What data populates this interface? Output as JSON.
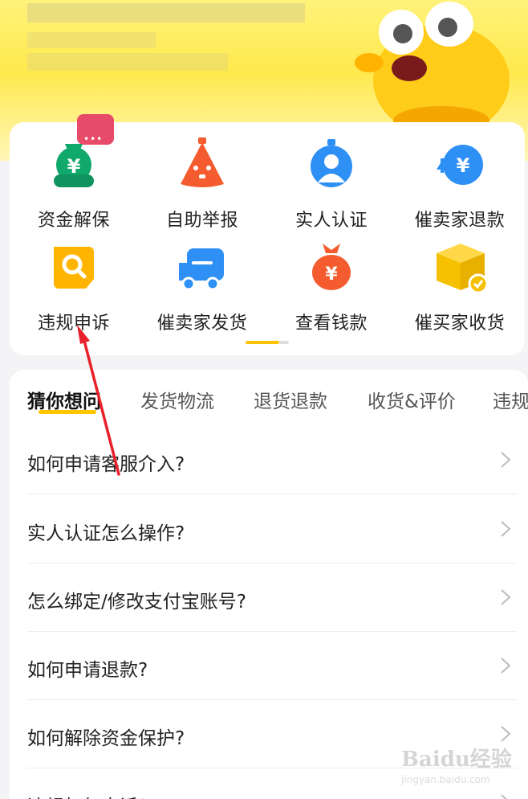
{
  "services": [
    {
      "label": "资金解保",
      "icon": "money-bag-icon",
      "color": "#11a86b"
    },
    {
      "label": "自助举报",
      "icon": "report-icon",
      "color": "#f45b2e"
    },
    {
      "label": "实人认证",
      "icon": "person-verify-icon",
      "color": "#2e8ff5"
    },
    {
      "label": "催卖家退款",
      "icon": "refund-icon",
      "color": "#2e8ff5"
    },
    {
      "label": "违规申诉",
      "icon": "appeal-search-icon",
      "color": "#ffb400"
    },
    {
      "label": "催卖家发货",
      "icon": "delivery-truck-icon",
      "color": "#2e8ff5"
    },
    {
      "label": "查看钱款",
      "icon": "money-sack-icon",
      "color": "#f45b2e"
    },
    {
      "label": "催买家收货",
      "icon": "package-check-icon",
      "color": "#f5c000"
    }
  ],
  "badge": {
    "text": "•••"
  },
  "faq": {
    "tabs": [
      "猜你想问",
      "发货物流",
      "退货退款",
      "收货&评价",
      "违规"
    ],
    "active_tab": 0,
    "questions": [
      "如何申请客服介入?",
      "实人认证怎么操作?",
      "怎么绑定/修改支付宝账号?",
      "如何申请退款?",
      "如何解除资金保护?",
      "违规如何申诉?"
    ]
  },
  "watermark": {
    "brand": "Baidu经验",
    "url": "jingyan.baidu.com"
  },
  "colors": {
    "accent": "#ffc600",
    "annotation": "#e8202a"
  }
}
